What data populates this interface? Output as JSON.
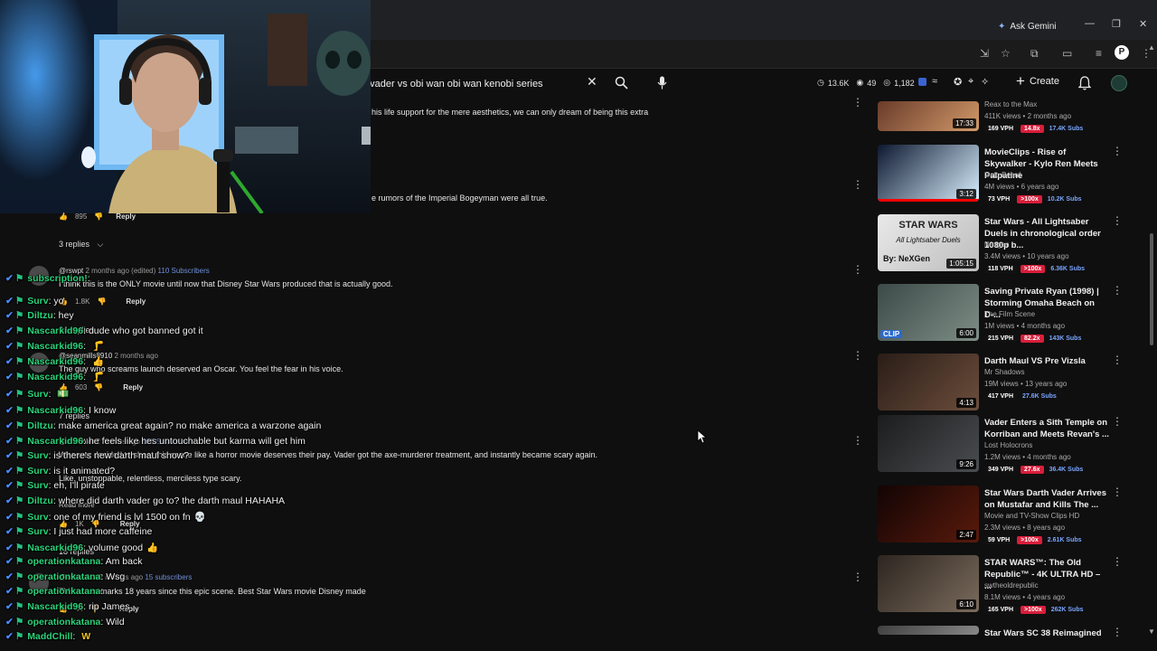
{
  "browser": {
    "ask_gemini": "Ask Gemini",
    "ext_letter": "P"
  },
  "youtube": {
    "search_query": "h vader vs obi wan obi wan kenobi series",
    "stats": {
      "views": "13.6K",
      "watching": "49",
      "count": "1,182"
    },
    "create_label": "Create"
  },
  "comments": {
    "line_top": "his life support for the mere aesthetics, we can only dream of being this extra",
    "line_rumors": "e rumors of the Imperial Bogeyman were all true.",
    "c1": {
      "likes": "895",
      "reply": "Reply",
      "replies": "3 replies"
    },
    "c2": {
      "handle": "@rswpt",
      "meta": "2 months ago (edited)",
      "subs": "110 Subscribers",
      "text": "I think this is the ONLY movie until now that Disney Star Wars produced that is actually good.",
      "likes": "1.8K",
      "reply": "Reply",
      "replies": "44 replies"
    },
    "c3": {
      "handle": "@seanmills8910",
      "meta": "2 months ago",
      "text": "The guy who screams launch deserved an Oscar. You feel the fear in his voice.",
      "likes": "603",
      "reply": "Reply",
      "replies": "7 replies"
    },
    "c4": {
      "handle": "@drstabler",
      "meta": "2 months ago",
      "subs": "196 Subscribers",
      "text": "Whoever decided to shoot this scene like a horror movie deserves their pay. Vader got the axe-murderer treatment, and instantly became scary again.",
      "text2": "Like, unstoppable, relentless, merciless type scary.",
      "read_more": "Read more",
      "likes": "1K",
      "reply": "Reply",
      "replies": "18 replies"
    },
    "c5": {
      "handle": "@sebastian",
      "meta": "2 months ago",
      "subs": "15 subscribers",
      "text": "This scene marks 18 years since this epic scene. Best Star Wars movie Disney made",
      "likes": "44",
      "reply": "Reply"
    }
  },
  "chat": [
    {
      "name": "subscription!",
      "msg": "",
      "emo": ""
    },
    {
      "name": "Surv",
      "msg": "yo",
      "emo": ""
    },
    {
      "name": "Diltzu",
      "msg": "hey",
      "emo": ""
    },
    {
      "name": "Nascarkid96",
      "msg": "dude who got banned got it",
      "emo": ""
    },
    {
      "name": "Nascarkid96",
      "msg": "",
      "emo": "🦵"
    },
    {
      "name": "Nascarkid96",
      "msg": "",
      "emo": "👍"
    },
    {
      "name": "Nascarkid96",
      "msg": "",
      "emo": "🦵"
    },
    {
      "name": "Surv",
      "msg": "",
      "emo": "💵"
    },
    {
      "name": "Nascarkid96",
      "msg": "I know",
      "emo": ""
    },
    {
      "name": "Diltzu",
      "msg": "make america great again? no make america a warzone again",
      "emo": ""
    },
    {
      "name": "Nascarkid96",
      "msg": "he feels like hes untouchable but karma will get him",
      "emo": ""
    },
    {
      "name": "Surv",
      "msg": "is there's new darth maul show?",
      "emo": ""
    },
    {
      "name": "Surv",
      "msg": "is it animated?",
      "emo": ""
    },
    {
      "name": "Surv",
      "msg": "eh, I'll pirate",
      "emo": ""
    },
    {
      "name": "Diltzu",
      "msg": "where did darth vader go to? the darth maul HAHAHA",
      "emo": ""
    },
    {
      "name": "Surv",
      "msg": "one of my friend is lvl 1500 on fn",
      "emo": "💀"
    },
    {
      "name": "Surv",
      "msg": "I just had more caffeine",
      "emo": ""
    },
    {
      "name": "Nascarkid96",
      "msg": "volume good",
      "emo": "👍"
    },
    {
      "name": "operationkatana",
      "msg": "Am back",
      "emo": ""
    },
    {
      "name": "operationkatana",
      "msg": "Wsg",
      "emo": ""
    },
    {
      "name": "operationkatana",
      "msg": "",
      "emo": ""
    },
    {
      "name": "Nascarkid96",
      "msg": "rip James",
      "emo": ""
    },
    {
      "name": "operationkatana",
      "msg": "Wild",
      "emo": ""
    },
    {
      "name": "MaddChill",
      "msg": "",
      "emo": "W"
    }
  ],
  "sidebar": [
    {
      "title": "",
      "channel": "Reax to the Max",
      "meta": "411K views • 2 months ago",
      "duration": "17:33",
      "vph": "169 VPH",
      "ratio": "14.8x",
      "subs": "17.4K Subs"
    },
    {
      "title": "MovieClips - Rise of Skywalker - Kylo Ren Meets Palpatine",
      "channel": "Octo Beard",
      "meta": "4M views • 6 years ago",
      "duration": "3:12",
      "vph": "73 VPH",
      "ratio": ">100x",
      "subs": "10.2K Subs"
    },
    {
      "title": "Star Wars - All Lightsaber Duels in chronological order 1080p b...",
      "channel": "Nexgen",
      "meta": "3.4M views • 10 years ago",
      "duration": "1:05:15",
      "vph": "118 VPH",
      "ratio": ">100x",
      "subs": "6.36K Subs",
      "thumb_text1": "STAR WARS",
      "thumb_text2": "All Lightsaber Duels",
      "thumb_text3": "By: NeXGen"
    },
    {
      "title": "Saving Private Ryan (1998) | Storming Omaha Beach on D-...",
      "channel": "The Film Scene",
      "meta": "1M views • 4 months ago",
      "duration": "6:00",
      "vph": "215 VPH",
      "ratio": "82.2x",
      "subs": "143K Subs",
      "clip": "CLIP"
    },
    {
      "title": "Darth Maul VS Pre Vizsla",
      "channel": "Mr Shadows",
      "meta": "19M views • 13 years ago",
      "duration": "4:13",
      "vph": "417 VPH",
      "ratio": "",
      "subs": "27.6K Subs"
    },
    {
      "title": "Vader Enters a Sith Temple on Korriban and Meets Revan's ...",
      "channel": "Lost Holocrons",
      "meta": "1.2M views • 4 months ago",
      "duration": "9:26",
      "vph": "349 VPH",
      "ratio": "27.6x",
      "subs": "36.4K Subs"
    },
    {
      "title": "Star Wars Darth Vader Arrives on Mustafar and Kills The ...",
      "channel": "Movie and TV-Show Clips HD",
      "meta": "2.3M views • 8 years ago",
      "duration": "2:47",
      "vph": "59 VPH",
      "ratio": ">100x",
      "subs": "2.61K Subs"
    },
    {
      "title": "STAR WARS™: The Old Republic™ - 4K ULTRA HD – ...",
      "channel": "swtheoldrepublic",
      "meta": "8.1M views • 4 years ago",
      "duration": "6:10",
      "vph": "165 VPH",
      "ratio": ">100x",
      "subs": "262K Subs"
    },
    {
      "title": "Star Wars SC 38 Reimagined",
      "channel": "",
      "meta": "",
      "duration": "",
      "vph": "",
      "ratio": "",
      "subs": ""
    }
  ]
}
